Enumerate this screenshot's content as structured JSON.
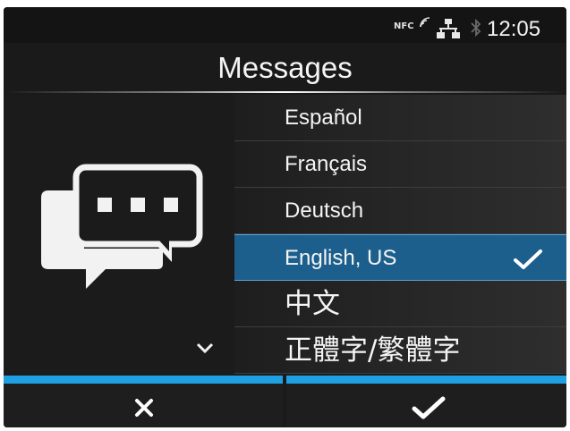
{
  "status_bar": {
    "nfc_label": "NFC",
    "time": "12:05",
    "icons": [
      "nfc-icon",
      "network-icon",
      "bluetooth-icon"
    ]
  },
  "header": {
    "title": "Messages"
  },
  "languages": [
    {
      "label": "Español",
      "selected": false
    },
    {
      "label": "Français",
      "selected": false
    },
    {
      "label": "Deutsch",
      "selected": false
    },
    {
      "label": "English, US",
      "selected": true
    },
    {
      "label": "中文",
      "selected": false
    },
    {
      "label": "正體字/繁體字",
      "selected": false
    }
  ],
  "footer": {
    "cancel_icon": "close-icon",
    "ok_icon": "checkmark-icon"
  },
  "colors": {
    "selection": "#1c5f8d",
    "accent": "#1fa0e3",
    "background": "#1b1b1b"
  }
}
